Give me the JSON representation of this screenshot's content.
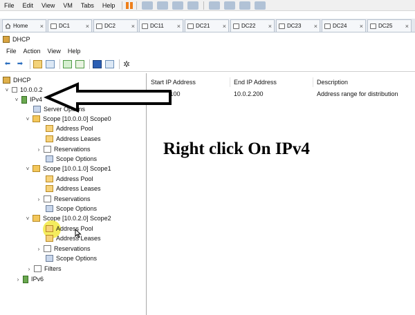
{
  "vm_menu": {
    "items": [
      "File",
      "Edit",
      "View",
      "VM",
      "Tabs",
      "Help"
    ]
  },
  "vm_tabs": [
    {
      "label": "Home",
      "icon": "home-icon"
    },
    {
      "label": "DC1"
    },
    {
      "label": "DC2"
    },
    {
      "label": "DC11"
    },
    {
      "label": "DC21"
    },
    {
      "label": "DC22"
    },
    {
      "label": "DC23"
    },
    {
      "label": "DC24"
    },
    {
      "label": "DC25"
    }
  ],
  "window": {
    "title": "DHCP"
  },
  "app_menu": {
    "items": [
      "File",
      "Action",
      "View",
      "Help"
    ]
  },
  "tree": {
    "root": "DHCP",
    "server": "10.0.0.2",
    "ipv4": "IPv4",
    "server_options": "Server Options",
    "scopes": [
      {
        "label": "Scope [10.0.0.0] Scope0",
        "children": [
          "Address Pool",
          "Address Leases",
          "Reservations",
          "Scope Options"
        ]
      },
      {
        "label": "Scope [10.0.1.0] Scope1",
        "children": [
          "Address Pool",
          "Address Leases",
          "Reservations",
          "Scope Options"
        ]
      },
      {
        "label": "Scope [10.0.2.0] Scope2",
        "children": [
          "Address Pool",
          "Address Leases",
          "Reservations",
          "Scope Options"
        ]
      }
    ],
    "filters": "Filters",
    "ipv6": "IPv6"
  },
  "details": {
    "columns": [
      "Start IP Address",
      "End IP Address",
      "Description"
    ],
    "rows": [
      {
        "start": "10.0.2.100",
        "end": "10.0.2.200",
        "description": "Address range for distribution"
      }
    ]
  },
  "annotation": {
    "text": "Right click On IPv4"
  },
  "colors": {
    "highlight": "#f0e628",
    "arrow": "#000000",
    "folder": "#f3c75b"
  }
}
